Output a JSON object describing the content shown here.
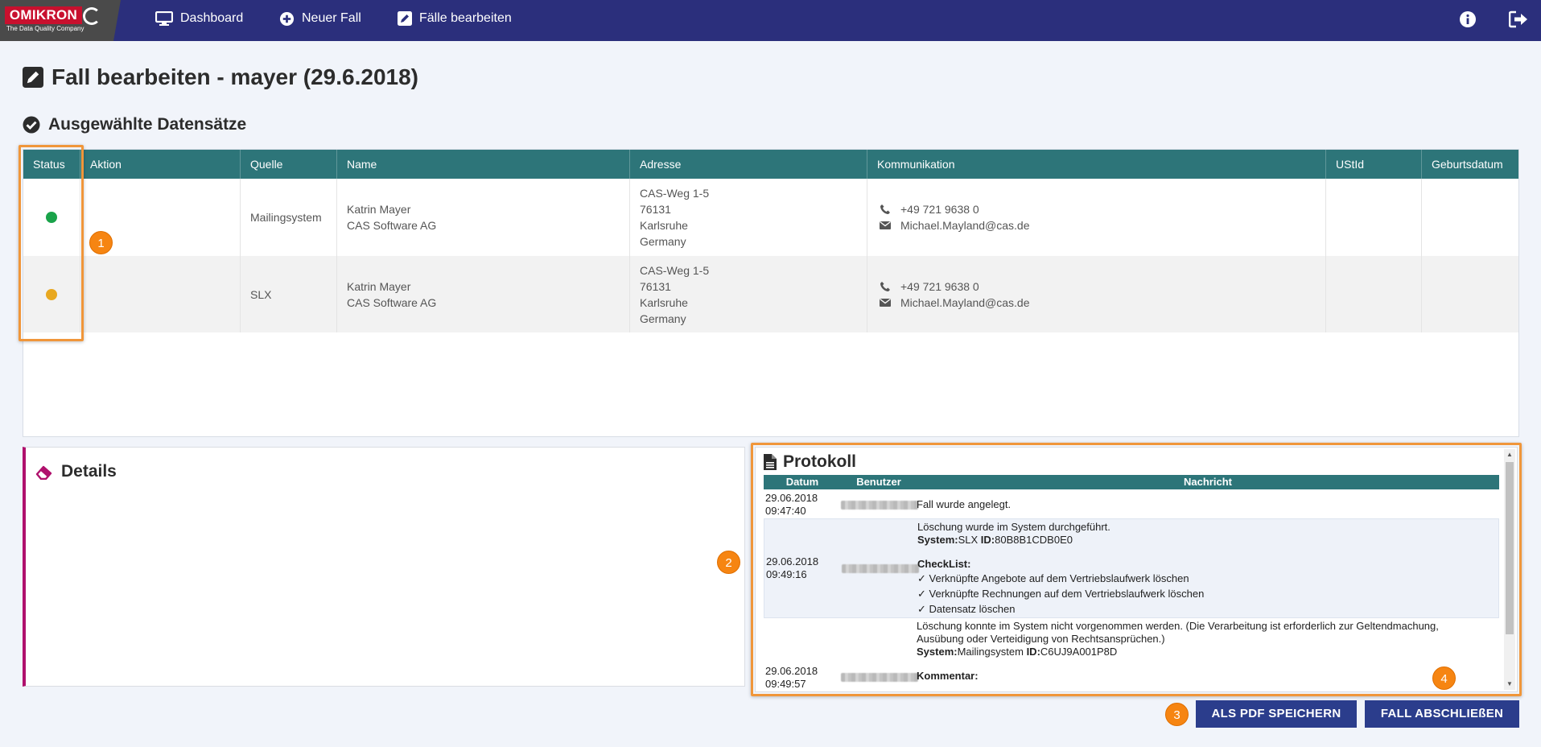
{
  "brand": {
    "name": "OMIKRON",
    "tagline": "The Data Quality Company"
  },
  "nav": {
    "items": [
      {
        "label": "Dashboard",
        "icon": "monitor-icon"
      },
      {
        "label": "Neuer Fall",
        "icon": "plus-circle-icon"
      },
      {
        "label": "Fälle bearbeiten",
        "icon": "edit-icon"
      }
    ],
    "right_icons": [
      "info-icon",
      "logout-icon"
    ]
  },
  "page": {
    "title": "Fall bearbeiten - mayer (29.6.2018)",
    "records_title": "Ausgewählte Datensätze",
    "details_title": "Details",
    "protokoll_title": "Protokoll"
  },
  "table": {
    "columns": [
      "Status",
      "Aktion",
      "Quelle",
      "Name",
      "Adresse",
      "Kommunikation",
      "UStId",
      "Geburtsdatum"
    ],
    "rows": [
      {
        "status_color": "#1aa34a",
        "aktion": "",
        "quelle": "Mailingsystem",
        "name": [
          "Katrin Mayer",
          "CAS Software AG"
        ],
        "adresse": [
          "CAS-Weg 1-5",
          "76131",
          "Karlsruhe",
          "Germany"
        ],
        "phone": "+49 721 9638 0",
        "email": "Michael.Mayland@cas.de",
        "ustid": "",
        "geburtsdatum": ""
      },
      {
        "status_color": "#e8a820",
        "aktion": "",
        "quelle": "SLX",
        "name": [
          "Katrin Mayer",
          "CAS Software AG"
        ],
        "adresse": [
          "CAS-Weg 1-5",
          "76131",
          "Karlsruhe",
          "Germany"
        ],
        "phone": "+49 721 9638 0",
        "email": "Michael.Mayland@cas.de",
        "ustid": "",
        "geburtsdatum": ""
      }
    ]
  },
  "protokoll": {
    "columns": [
      "Datum",
      "Benutzer",
      "Nachricht"
    ],
    "rows": [
      {
        "date": "29.06.2018",
        "time": "09:47:40",
        "message": [
          "Fall wurde angelegt."
        ]
      },
      {
        "date": "29.06.2018",
        "time": "09:49:16",
        "message_intro": "Löschung wurde im System durchgeführt.",
        "system_label": "System:",
        "system_value": "SLX",
        "id_label": "ID:",
        "id_value": "80B8B1CDB0E0",
        "checklist_label": "CheckList:",
        "checklist": [
          "✓ Verknüpfte Angebote auf dem Vertriebslaufwerk löschen",
          "✓ Verknüpfte Rechnungen auf dem Vertriebslaufwerk löschen",
          "✓ Datensatz löschen"
        ]
      },
      {
        "date": "29.06.2018",
        "time": "09:49:57",
        "message_intro": "Löschung konnte im System nicht vorgenommen werden. (Die Verarbeitung ist erforderlich zur Geltendmachung,",
        "message_intro2": "Ausübung oder Verteidigung von Rechtsansprüchen.)",
        "system_label": "System:",
        "system_value": "Mailingsystem",
        "id_label": "ID:",
        "id_value": "C6UJ9A001P8D",
        "comment_label": "Kommentar:"
      }
    ]
  },
  "buttons": {
    "pdf": "ALS PDF SPEICHERN",
    "close": "FALL ABSCHLIEßEN"
  },
  "badges": [
    "1",
    "2",
    "3",
    "4"
  ],
  "colors": {
    "nav_bg": "#2b2f7c",
    "table_header": "#2d7579",
    "highlight": "#f0963a",
    "badge": "#f68512",
    "details_accent": "#b0116d",
    "button": "#2b3d8c"
  }
}
